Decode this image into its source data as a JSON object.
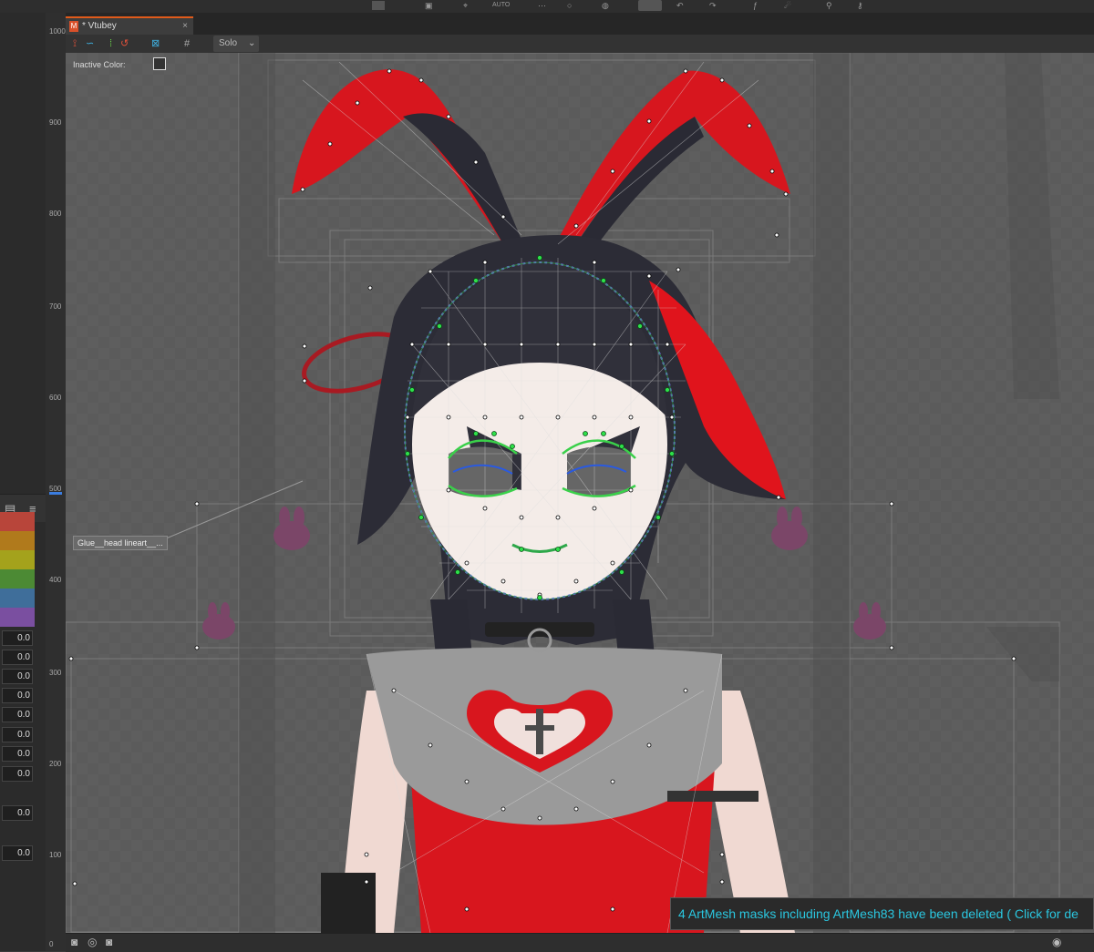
{
  "topbar": {
    "auto_label": "AUTO"
  },
  "tab": {
    "title": "* Vtubey",
    "close": "×",
    "icon_letter": "M"
  },
  "toolstrip": {
    "solo_label": "Solo",
    "solo_chevron": "⌄"
  },
  "canvas": {
    "inactive_color_label": "Inactive Color:",
    "glue_label": "Glue__head lineart__..."
  },
  "ruler": {
    "ticks": [
      "1000",
      "900",
      "800",
      "700",
      "600",
      "500",
      "400",
      "300",
      "200",
      "100",
      "0"
    ]
  },
  "left_panel": {
    "swatch_colors": [
      "#b8453a",
      "#b07a1c",
      "#a4a21c",
      "#4c8a34",
      "#3f6e9a",
      "#7a4fa0"
    ],
    "values": [
      "0.0",
      "0.0",
      "0.0",
      "0.0",
      "0.0",
      "0.0",
      "0.0",
      "0.0",
      "0.0",
      "0.0"
    ]
  },
  "notification": {
    "text": "4 ArtMesh masks including ArtMesh83 have been deleted ( Click for de"
  },
  "icons": [
    "copy-icon",
    "menu-icon",
    "camera-icon",
    "multi-camera-icon",
    "camera-settings-icon",
    "circle-icon"
  ]
}
